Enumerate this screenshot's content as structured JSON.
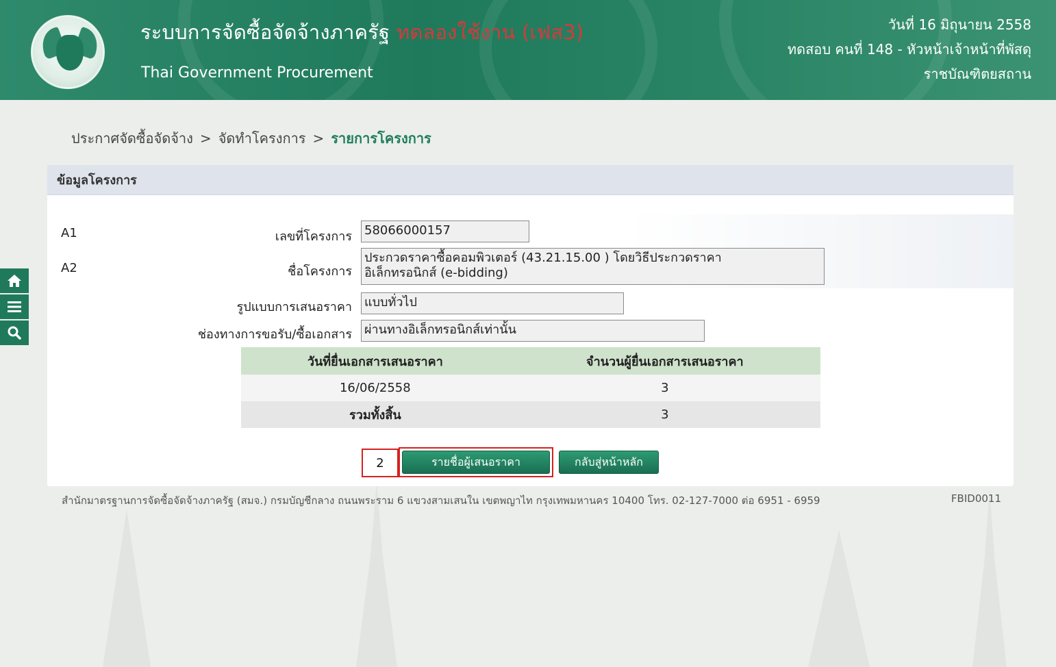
{
  "header": {
    "title": "ระบบการจัดซื้อจัดจ้างภาครัฐ",
    "trial_label": "ทดลองใช้งาน (เฟส3)",
    "subtitle": "Thai Government Procurement",
    "date": "วันที่ 16 มิถุนายน 2558",
    "user": "ทดสอบ คนที่ 148 - หัวหน้าเจ้าหน้าที่พัสดุ",
    "org": "ราชบัณฑิตยสถาน"
  },
  "breadcrumb": {
    "item1": "ประกาศจัดซื้อจัดจ้าง",
    "sep": ">",
    "item2": "จัดทำโครงการ",
    "current": "รายการโครงการ"
  },
  "panel": {
    "title": "ข้อมูลโครงการ",
    "a1_code": "A1",
    "a2_code": "A2",
    "project_no_label": "เลขที่โครงการ",
    "project_no_value": "58066000157",
    "project_name_label": "ชื่อโครงการ",
    "project_name_line1": "ประกวดราคาซื้อคอมพิวเตอร์ (43.21.15.00 ) โดยวิธีประกวดราคา",
    "project_name_line2": "อิเล็กทรอนิกส์ (e-bidding)",
    "bid_format_label": "รูปแบบการเสนอราคา",
    "bid_format_value": "แบบทั่วไป",
    "channel_label": "ช่องทางการขอรับ/ซื้อเอกสาร",
    "channel_value": "ผ่านทางอิเล็กทรอนิกส์เท่านั้น"
  },
  "table": {
    "headers": [
      "วันที่ยื่นเอกสารเสนอราคา",
      "จำนวนผู้ยื่นเอกสารเสนอราคา"
    ],
    "rows": [
      {
        "date": "16/06/2558",
        "count": "3"
      }
    ],
    "total_label": "รวมทั้งสิ้น",
    "total_count": "3"
  },
  "buttons": {
    "bidders": "รายชื่อผู้เสนอราคา",
    "home": "กลับสู่หน้าหลัก"
  },
  "callout": "2",
  "footer": {
    "text": "สำนักมาตรฐานการจัดซื้อจัดจ้างภาครัฐ (สมจ.) กรมบัญชีกลาง ถนนพระราม 6 แขวงสามเสนใน เขตพญาไท กรุงเทพมหานคร 10400 โทร. 02-127-7000 ต่อ 6951 - 6959",
    "code": "FBID0011"
  },
  "colors": {
    "header_green": "#1f7a5c",
    "trial_red": "#d63a3a",
    "highlight_red": "#d62020",
    "table_header": "#cfe3cc"
  },
  "icons": {
    "tool1": "home-icon",
    "tool2": "menu-icon",
    "tool3": "search-icon"
  }
}
